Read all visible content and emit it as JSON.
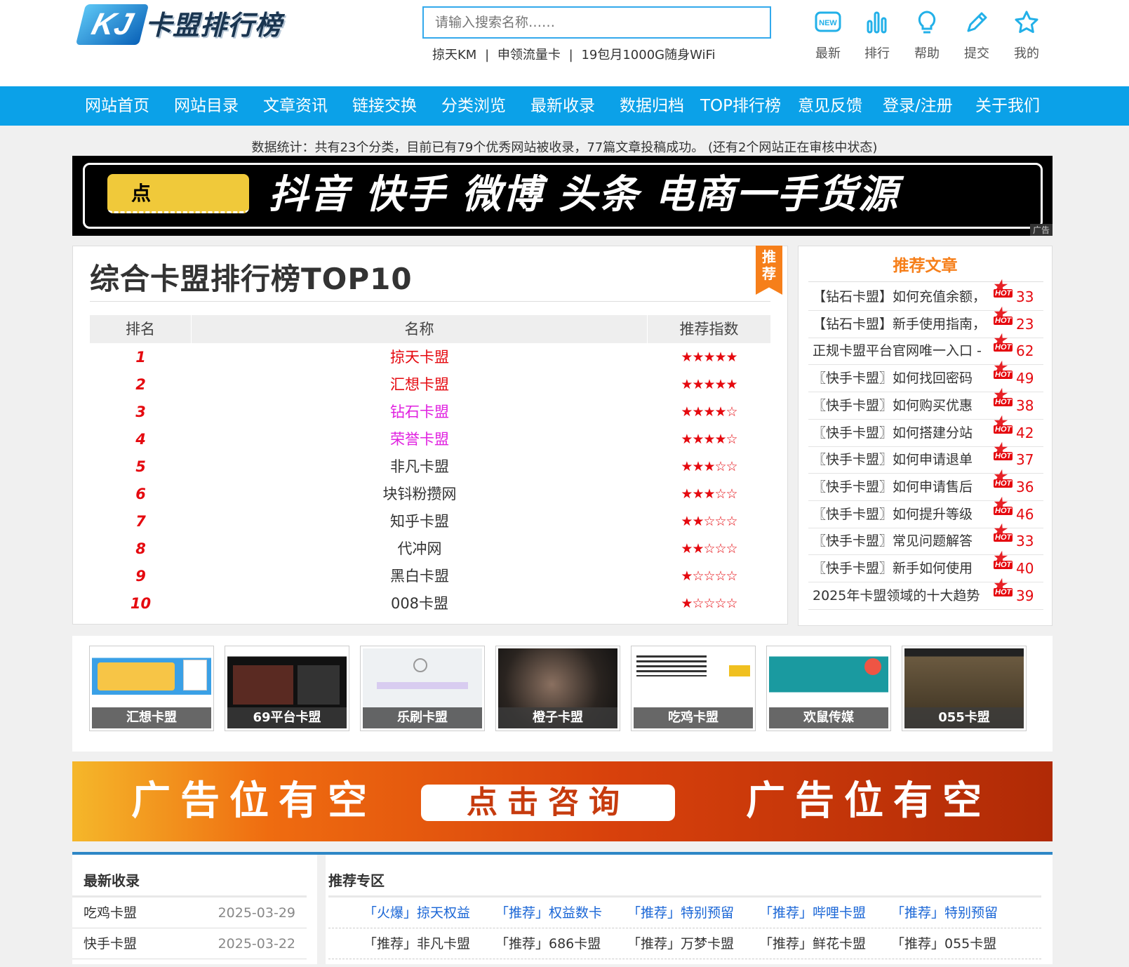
{
  "header": {
    "logo_mark": "KJ",
    "logo_text": "卡盟排行榜",
    "search_placeholder": "请输入搜索名称……",
    "hot_words": [
      "掠天KM",
      "|",
      "申领流量卡",
      "|",
      "19包月1000G随身WiFi"
    ],
    "quick_links": [
      {
        "label": "最新",
        "icon": "new-icon"
      },
      {
        "label": "排行",
        "icon": "bar-chart-icon"
      },
      {
        "label": "帮助",
        "icon": "lightbulb-icon"
      },
      {
        "label": "提交",
        "icon": "pencil-icon"
      },
      {
        "label": "我的",
        "icon": "star-icon"
      }
    ]
  },
  "nav": [
    "网站首页",
    "网站目录",
    "文章资讯",
    "链接交换",
    "分类浏览",
    "最新收录",
    "数据归档",
    "TOP排行榜",
    "意见反馈",
    "登录/注册",
    "关于我们"
  ],
  "stats": "数据统计：共有23个分类，目前已有79个优秀网站被收录，77篇文章投稿成功。 (还有2个网站正在审核中状态)",
  "banner_top": {
    "button": "点",
    "text": "抖音  快手  微博  头条  电商一手货源",
    "ad_tag": "广告"
  },
  "ranking": {
    "title": "综合卡盟排行榜TOP10",
    "ribbon": "推荐",
    "headers": [
      "排名",
      "名称",
      "推荐指数"
    ],
    "rows": [
      {
        "rank": "1",
        "name": "掠天卡盟",
        "stars": "★★★★★",
        "color": "#e5090f"
      },
      {
        "rank": "2",
        "name": "汇想卡盟",
        "stars": "★★★★★",
        "color": "#e5090f"
      },
      {
        "rank": "3",
        "name": "钻石卡盟",
        "stars": "★★★★☆",
        "color": "#e020e0"
      },
      {
        "rank": "4",
        "name": "荣誉卡盟",
        "stars": "★★★★☆",
        "color": "#e020e0"
      },
      {
        "rank": "5",
        "name": "非凡卡盟",
        "stars": "★★★☆☆",
        "color": "#333333"
      },
      {
        "rank": "6",
        "name": "块钭粉攒网",
        "stars": "★★★☆☆",
        "color": "#333333"
      },
      {
        "rank": "7",
        "name": "知乎卡盟",
        "stars": "★★☆☆☆",
        "color": "#333333"
      },
      {
        "rank": "8",
        "name": "代冲网",
        "stars": "★★☆☆☆",
        "color": "#333333"
      },
      {
        "rank": "9",
        "name": "黑白卡盟",
        "stars": "★☆☆☆☆",
        "color": "#333333"
      },
      {
        "rank": "10",
        "name": "008卡盟",
        "stars": "★☆☆☆☆",
        "color": "#333333"
      }
    ]
  },
  "articles": {
    "title": "推荐文章",
    "hot_label": "HOT",
    "items": [
      {
        "title": "【钻石卡盟】如何充值余额，",
        "count": "33"
      },
      {
        "title": "【钻石卡盟】新手使用指南，",
        "count": "23"
      },
      {
        "title": "正规卡盟平台官网唯一入口 -",
        "count": "62"
      },
      {
        "title": "〖快手卡盟〗如何找回密码",
        "count": "49"
      },
      {
        "title": "〖快手卡盟〗如何购买优惠",
        "count": "38"
      },
      {
        "title": "〖快手卡盟〗如何搭建分站",
        "count": "42"
      },
      {
        "title": "〖快手卡盟〗如何申请退单",
        "count": "37"
      },
      {
        "title": "〖快手卡盟〗如何申请售后",
        "count": "36"
      },
      {
        "title": "〖快手卡盟〗如何提升等级",
        "count": "46"
      },
      {
        "title": "〖快手卡盟〗常见问题解答",
        "count": "33"
      },
      {
        "title": "〖快手卡盟〗新手如何使用",
        "count": "40"
      },
      {
        "title": "2025年卡盟领域的十大趋势",
        "count": "39"
      }
    ]
  },
  "thumbnails": [
    "汇想卡盟",
    "69平台卡盟",
    "乐刷卡盟",
    "橙子卡盟",
    "吃鸡卡盟",
    "欢鼠传媒",
    "055卡盟"
  ],
  "banner_bottom": {
    "left": "广告位有空",
    "center": "点击咨询",
    "right": "广告位有空"
  },
  "newest": {
    "title": "最新收录",
    "items": [
      {
        "name": "吃鸡卡盟",
        "date": "2025-03-29"
      },
      {
        "name": "快手卡盟",
        "date": "2025-03-22"
      }
    ]
  },
  "recommend": {
    "title": "推荐专区",
    "rows": [
      [
        "「火爆」掠天权益",
        "「推荐」权益数卡",
        "「推荐」特别预留",
        "「推荐」哔哩卡盟",
        "「推荐」特别预留"
      ],
      [
        "「推荐」非凡卡盟",
        "「推荐」686卡盟",
        "「推荐」万梦卡盟",
        "「推荐」鲜花卡盟",
        "「推荐」055卡盟"
      ]
    ]
  },
  "colors": {
    "accent": "#0ba1e8",
    "hot": "#e5090f",
    "orange": "#f67f1a",
    "link_blue": "#1a66d6"
  }
}
